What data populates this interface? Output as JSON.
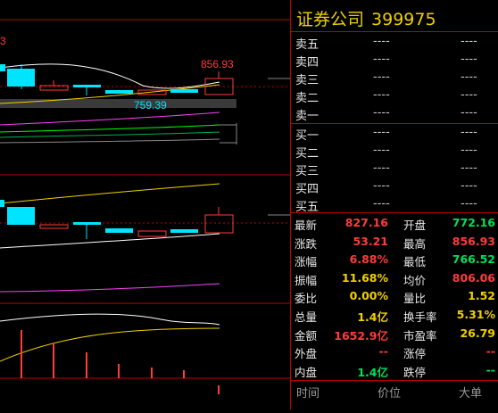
{
  "panel": {
    "title_name": "证券公司",
    "title_code": "399975",
    "sells": [
      {
        "label": "卖五",
        "price": "----",
        "volume": "----"
      },
      {
        "label": "卖四",
        "price": "----",
        "volume": "----"
      },
      {
        "label": "卖三",
        "price": "----",
        "volume": "----"
      },
      {
        "label": "卖二",
        "price": "----",
        "volume": "----"
      },
      {
        "label": "卖一",
        "price": "----",
        "volume": "----"
      }
    ],
    "buys": [
      {
        "label": "买一",
        "price": "----",
        "volume": "----"
      },
      {
        "label": "买二",
        "price": "----",
        "volume": "----"
      },
      {
        "label": "买三",
        "price": "----",
        "volume": "----"
      },
      {
        "label": "买四",
        "price": "----",
        "volume": "----"
      },
      {
        "label": "买五",
        "price": "----",
        "volume": "----"
      }
    ],
    "stats": [
      {
        "k1": "最新",
        "v1": "827.16",
        "c1": "#ff3c3c",
        "k2": "开盘",
        "v2": "772.16",
        "c2": "#00e05a"
      },
      {
        "k1": "涨跌",
        "v1": "53.21",
        "c1": "#ff3c3c",
        "k2": "最高",
        "v2": "856.93",
        "c2": "#ff3c3c"
      },
      {
        "k1": "涨幅",
        "v1": "6.88%",
        "c1": "#ff3c3c",
        "k2": "最低",
        "v2": "766.52",
        "c2": "#00e05a"
      },
      {
        "k1": "振幅",
        "v1": "11.68%",
        "c1": "#f0d000",
        "k2": "均价",
        "v2": "806.06",
        "c2": "#ff3c3c"
      },
      {
        "k1": "委比",
        "v1": "0.00%",
        "c1": "#f0d000",
        "k2": "量比",
        "v2": "1.52",
        "c2": "#f0d000"
      },
      {
        "k1": "总量",
        "v1": "1.4亿",
        "c1": "#f0d000",
        "k2": "换手率",
        "v2": "5.31%",
        "c2": "#f0d000"
      },
      {
        "k1": "金额",
        "v1": "1652.9亿",
        "c1": "#ff3c3c",
        "k2": "市盈率",
        "v2": "26.79",
        "c2": "#f0d000"
      },
      {
        "k1": "外盘",
        "v1": "--",
        "c1": "#ff3c3c",
        "k2": "涨停",
        "v2": "--",
        "c2": "#ff3c3c"
      },
      {
        "k1": "内盘",
        "v1": "1.4亿",
        "c1": "#00e05a",
        "k2": "跌停",
        "v2": "--",
        "c2": "#00e05a"
      }
    ],
    "footer": {
      "time": "时间",
      "price": "价位",
      "volume": "大单"
    }
  },
  "chart": {
    "high_label": "856.93",
    "low_label": "759.39",
    "corner_label": "3",
    "colors": {
      "up": "#ff3c3c",
      "down": "#00e5ff",
      "ma1": "#ffffff",
      "ma2": "#f0d000",
      "ma3": "#ff40ff",
      "ma4": "#00ff00",
      "grid": "#c00000"
    }
  }
}
